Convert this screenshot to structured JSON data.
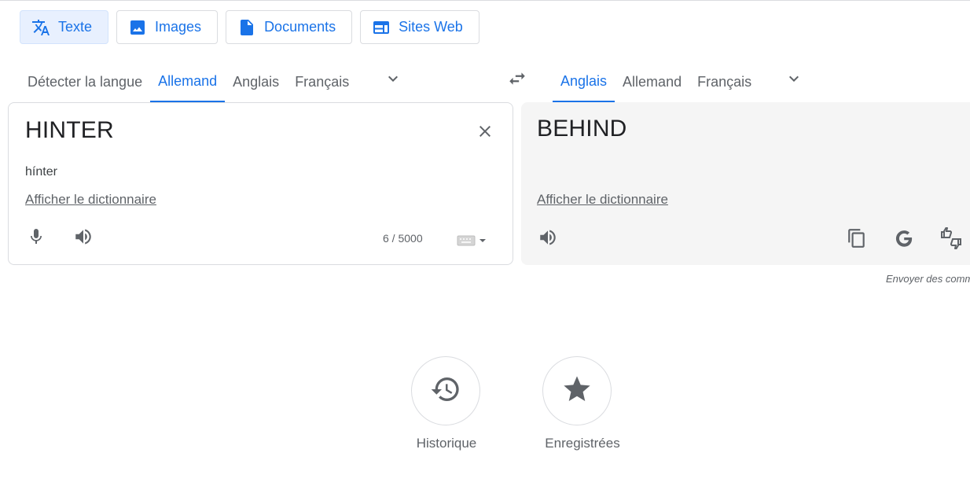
{
  "mode_tabs": [
    {
      "label": "Texte",
      "icon": "translate-icon",
      "active": true
    },
    {
      "label": "Images",
      "icon": "image-icon",
      "active": false
    },
    {
      "label": "Documents",
      "icon": "document-icon",
      "active": false
    },
    {
      "label": "Sites Web",
      "icon": "website-icon",
      "active": false
    }
  ],
  "source_langs": [
    {
      "label": "Détecter la langue",
      "active": false
    },
    {
      "label": "Allemand",
      "active": true
    },
    {
      "label": "Anglais",
      "active": false
    },
    {
      "label": "Français",
      "active": false
    }
  ],
  "target_langs": [
    {
      "label": "Anglais",
      "active": true
    },
    {
      "label": "Allemand",
      "active": false
    },
    {
      "label": "Français",
      "active": false
    }
  ],
  "source": {
    "text": "HINTER",
    "transliteration": "hínter",
    "dictionary_link": "Afficher le dictionnaire",
    "char_count": "6 / 5000"
  },
  "target": {
    "text": "BEHIND",
    "dictionary_link": "Afficher le dictionnaire"
  },
  "feedback_text": "Envoyer des comm",
  "bottom": {
    "history_label": "Historique",
    "saved_label": "Enregistrées"
  },
  "colors": {
    "accent": "#1a73e8",
    "icon_gray": "#5f6368",
    "target_panel_bg": "#f5f5f5"
  }
}
